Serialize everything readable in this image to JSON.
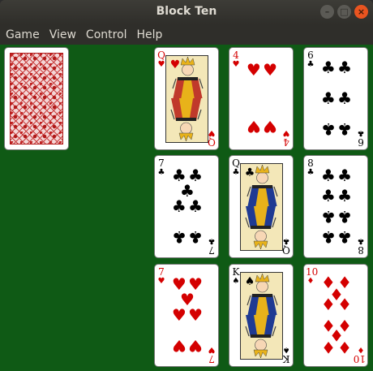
{
  "window": {
    "title": "Block Ten",
    "buttons": {
      "minimize": "–",
      "maximize": "□",
      "close": "×"
    }
  },
  "menu": [
    "Game",
    "View",
    "Control",
    "Help"
  ],
  "stock": {
    "face_down": true,
    "back_color": "#b01818"
  },
  "tableau": [
    {
      "rank": "Q",
      "suit": "♥",
      "color": "red"
    },
    {
      "rank": "4",
      "suit": "♥",
      "color": "red"
    },
    {
      "rank": "6",
      "suit": "♣",
      "color": "black"
    },
    {
      "rank": "7",
      "suit": "♣",
      "color": "black"
    },
    {
      "rank": "Q",
      "suit": "♣",
      "color": "black"
    },
    {
      "rank": "8",
      "suit": "♣",
      "color": "black"
    },
    {
      "rank": "7",
      "suit": "♥",
      "color": "red"
    },
    {
      "rank": "K",
      "suit": "♠",
      "color": "black"
    },
    {
      "rank": "10",
      "suit": "♦",
      "color": "red"
    }
  ],
  "colors": {
    "felt": "#0f5a15",
    "red_suit": "#d40000",
    "black_suit": "#000000"
  }
}
